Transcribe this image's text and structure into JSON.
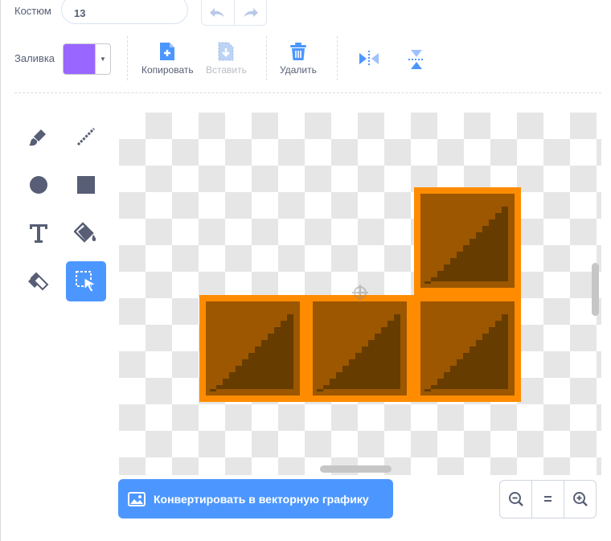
{
  "costume": {
    "label": "Костюм",
    "value": "13"
  },
  "fill": {
    "label": "Заливка",
    "color": "#9966ff",
    "dropdown_icon": "caret-down-icon"
  },
  "history": {
    "undo_icon": "undo-icon",
    "redo_icon": "redo-icon"
  },
  "actions": {
    "copy": {
      "label": "Копировать",
      "icon": "copy-icon"
    },
    "paste": {
      "label": "Вставить",
      "icon": "paste-icon"
    },
    "delete": {
      "label": "Удалить",
      "icon": "trash-icon"
    },
    "flip_horizontal": {
      "icon": "flip-horizontal-icon"
    },
    "flip_vertical": {
      "icon": "flip-vertical-icon"
    }
  },
  "tools": [
    "brush",
    "line",
    "circle",
    "rectangle",
    "text",
    "fill",
    "eraser",
    "select"
  ],
  "active_tool": "select",
  "convert": {
    "label": "Конвертировать в векторную графику",
    "icon": "image-icon"
  },
  "zoom": {
    "zoom_out_icon": "zoom-out-icon",
    "reset_label": "=",
    "zoom_in_icon": "zoom-in-icon"
  },
  "colors": {
    "accent": "#4c97ff",
    "block_orange": "#ff8c00",
    "block_fill": "#9c5700",
    "block_shadow": "#663c00"
  }
}
